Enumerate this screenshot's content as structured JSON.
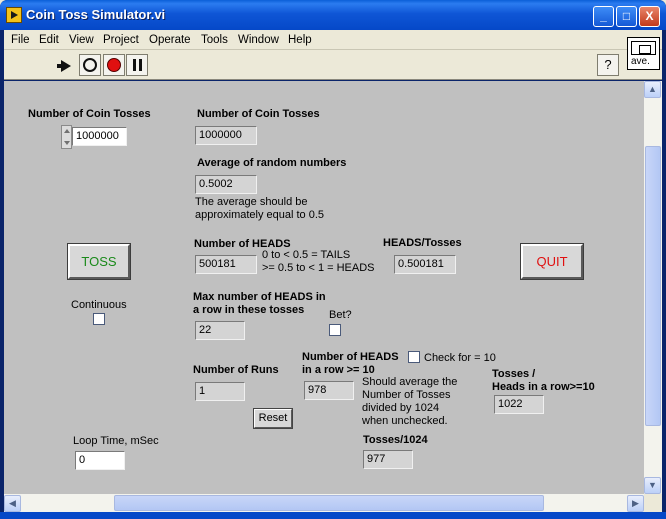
{
  "window": {
    "title": "Coin Toss Simulator.vi",
    "minimize": "_",
    "maximize": "□",
    "close": "X"
  },
  "menu": [
    "File",
    "Edit",
    "View",
    "Project",
    "Operate",
    "Tools",
    "Window",
    "Help"
  ],
  "toolbar": {
    "help": "?",
    "vi_icon_label": "ave."
  },
  "panel": {
    "tosses_control_label": "Number of Coin Tosses",
    "tosses_control_value": "1000000",
    "tosses_indicator_label": "Number of Coin Tosses",
    "tosses_indicator_value": "1000000",
    "average_label": "Average of random numbers",
    "average_value": "0.5002",
    "average_note": "The average should be\napproximately equal to 0.5",
    "toss_button": "TOSS",
    "quit_button": "QUIT",
    "heads_label": "Number of HEADS",
    "heads_value": "500181",
    "heads_rule": "0 to < 0.5 = TAILS\n>= 0.5 to < 1 = HEADS",
    "ratio_label": "HEADS/Tosses",
    "ratio_value": "0.500181",
    "continuous_label": "Continuous",
    "max_row_label": "Max number of HEADS in\na row in these tosses",
    "max_row_value": "22",
    "bet_label": "Bet?",
    "runs_label": "Number of Runs",
    "runs_value": "1",
    "heads_row_label": "Number of HEADS\nin a row >= 10",
    "heads_row_value": "978",
    "check_label": "Check for = 10",
    "heads_row_note": "Should average the\nNumber of Tosses\ndivided by 1024\nwhen unchecked.",
    "tosses_per_row_label": "Tosses /\nHeads in a row>=10",
    "tosses_per_row_value": "1022",
    "reset_button": "Reset",
    "loop_time_label": "Loop Time, mSec",
    "loop_time_value": "0",
    "tosses_1024_label": "Tosses/1024",
    "tosses_1024_value": "977"
  }
}
